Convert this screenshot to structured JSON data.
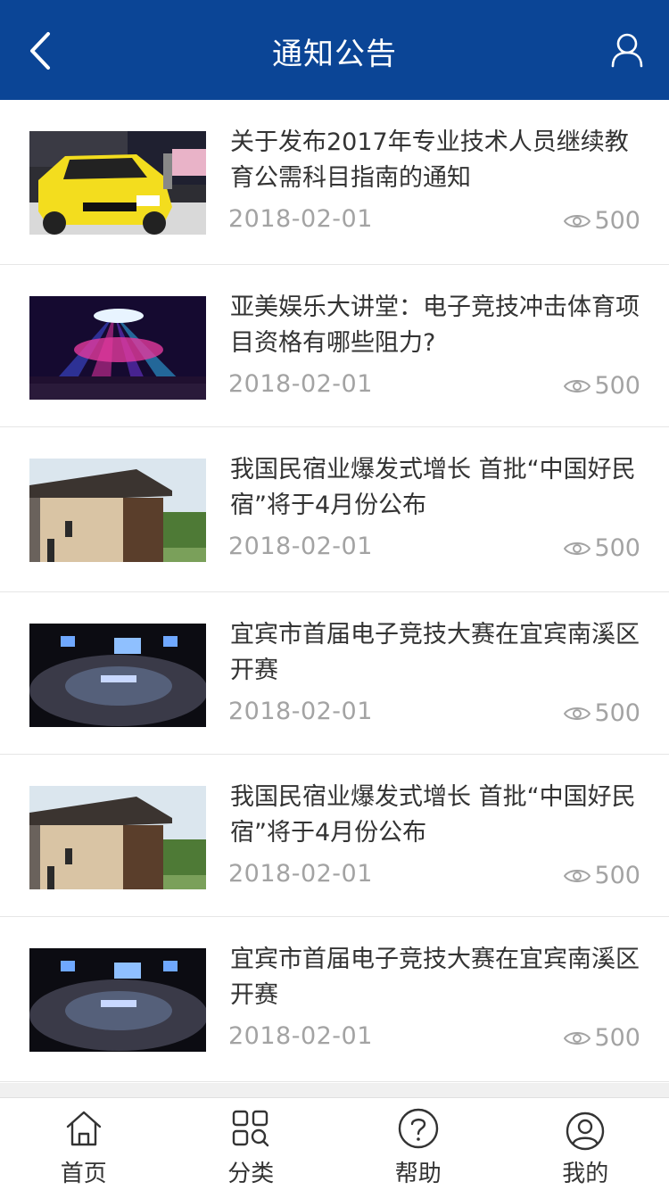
{
  "header": {
    "title": "通知公告"
  },
  "notices": [
    {
      "title": "关于发布2017年专业技术人员继续教育公需科目指南的通知",
      "date": "2018-02-01",
      "views": "500",
      "image": "yellow-car-photo"
    },
    {
      "title": "亚美娱乐大讲堂：电子竞技冲击体育项目资格有哪些阻力?",
      "date": "2018-02-01",
      "views": "500",
      "image": "concert-lights-photo"
    },
    {
      "title": "我国民宿业爆发式增长 首批“中国好民宿”将于4月份公布",
      "date": "2018-02-01",
      "views": "500",
      "image": "farmhouse-photo"
    },
    {
      "title": "宜宾市首届电子竞技大赛在宜宾南溪区开赛",
      "date": "2018-02-01",
      "views": "500",
      "image": "esports-arena-photo"
    },
    {
      "title": "我国民宿业爆发式增长 首批“中国好民宿”将于4月份公布",
      "date": "2018-02-01",
      "views": "500",
      "image": "farmhouse-photo"
    },
    {
      "title": "宜宾市首届电子竞技大赛在宜宾南溪区开赛",
      "date": "2018-02-01",
      "views": "500",
      "image": "esports-arena-photo"
    }
  ],
  "tabbar": {
    "home": "首页",
    "category": "分类",
    "help": "帮助",
    "mine": "我的"
  },
  "colors": {
    "header_bg": "#0b4596",
    "meta_text": "#a3a3a3"
  }
}
